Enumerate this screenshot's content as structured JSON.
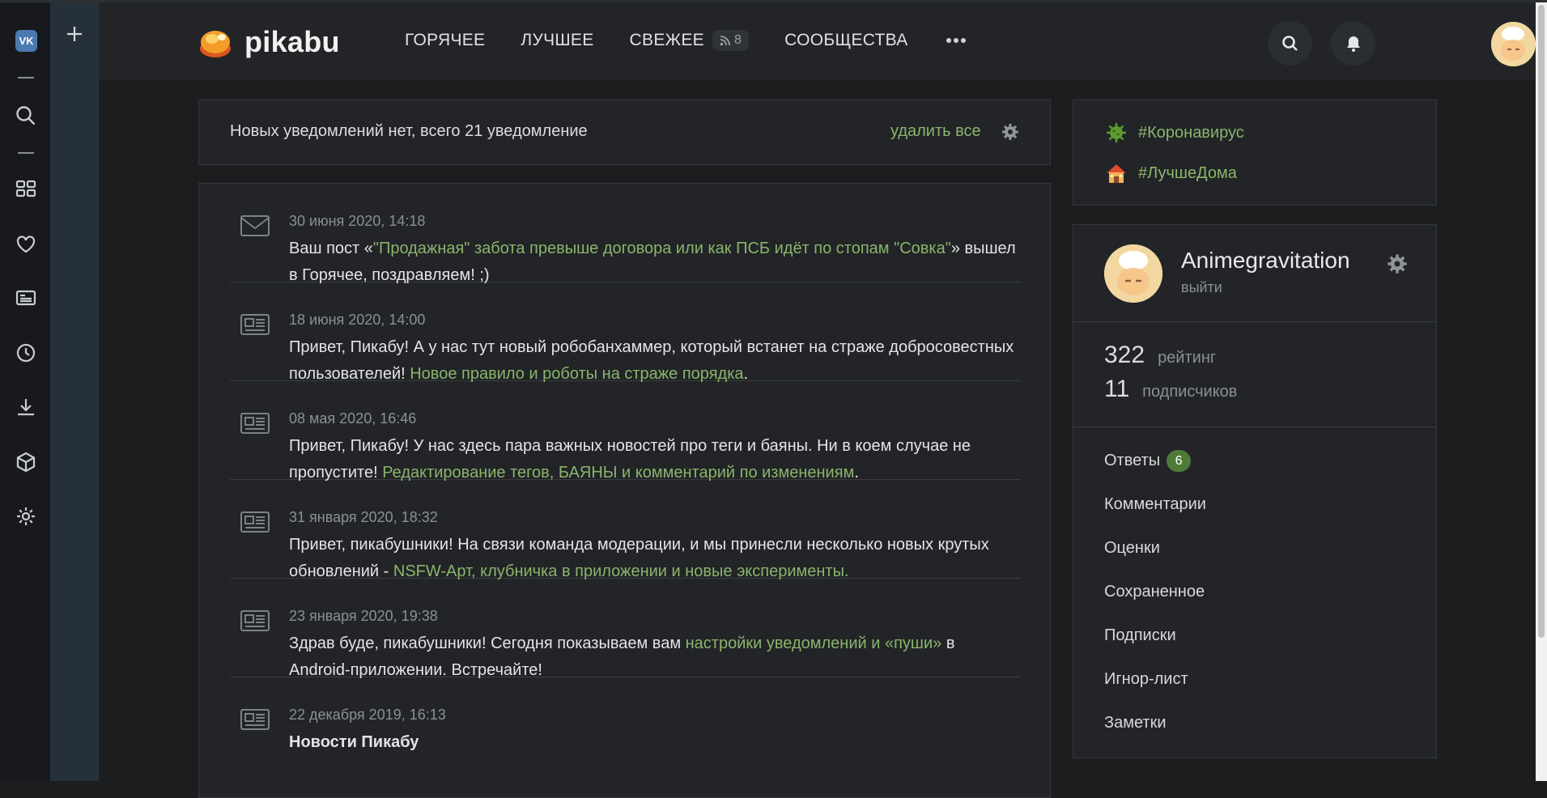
{
  "app": {
    "brand": "pikabu"
  },
  "nav": {
    "hot": "ГОРЯЧЕЕ",
    "best": "ЛУЧШЕЕ",
    "fresh": "СВЕЖЕЕ",
    "fresh_count": "8",
    "communities": "СООБЩЕСТВА"
  },
  "notifications": {
    "summary": "Новых уведомлений нет, всего 21 уведомление",
    "delete_all": "удалить все",
    "items": [
      {
        "icon": "envelope-icon",
        "date": "30 июня 2020, 14:18",
        "pre": "Ваш пост «",
        "link": "\"Продажная\" забота превыше договора или как ПСБ идёт по стопам \"Совка\"",
        "post": "» вышел в Горячее, поздравляем! ;)"
      },
      {
        "icon": "newspaper-icon",
        "date": "18 июня 2020, 14:00",
        "pre": "Привет, Пикабу! А у нас тут новый робобанхаммер, который встанет на страже добросовестных пользователей! ",
        "link": "Новое правило и роботы на страже порядка",
        "post": "."
      },
      {
        "icon": "newspaper-icon",
        "date": "08 мая 2020, 16:46",
        "pre": "Привет, Пикабу! У нас здесь пара важных новостей про теги и баяны. Ни в коем случае не пропустите! ",
        "link": "Редактирование тегов, БАЯНЫ и комментарий по изменениям",
        "post": "."
      },
      {
        "icon": "newspaper-icon",
        "date": "31 января 2020, 18:32",
        "pre": "Привет, пикабушники! На связи команда модерации, и мы принесли несколько новых крутых обновлений - ",
        "link": "NSFW-Арт, клубничка в приложении и новые эксперименты.",
        "post": ""
      },
      {
        "icon": "newspaper-icon",
        "date": "23 января 2020, 19:38",
        "pre": "Здрав буде, пикабушники! Сегодня показываем вам ",
        "link": "настройки уведомлений и «пуши»",
        "post": " в Android-приложении. Встречайте!"
      },
      {
        "icon": "newspaper-icon",
        "date": "22 декабря 2019, 16:13",
        "bold": "Новости Пикабу"
      }
    ]
  },
  "tags": [
    {
      "label": "#Коронавирус",
      "icon": "virus-icon"
    },
    {
      "label": "#ЛучшеДома",
      "icon": "house-icon"
    }
  ],
  "profile": {
    "username": "Animegravitation",
    "logout": "выйти",
    "rating_value": "322",
    "rating_label": "рейтинг",
    "subs_value": "11",
    "subs_label": "подписчиков",
    "menu": {
      "answers": "Ответы",
      "answers_count": "6",
      "comments": "Комментарии",
      "ratings": "Оценки",
      "saved": "Сохраненное",
      "subscriptions": "Подписки",
      "ignore": "Игнор-лист",
      "notes": "Заметки"
    }
  },
  "colors": {
    "accent_green": "#8ab56b",
    "background": "#1b1d1f",
    "card": "#222427"
  }
}
